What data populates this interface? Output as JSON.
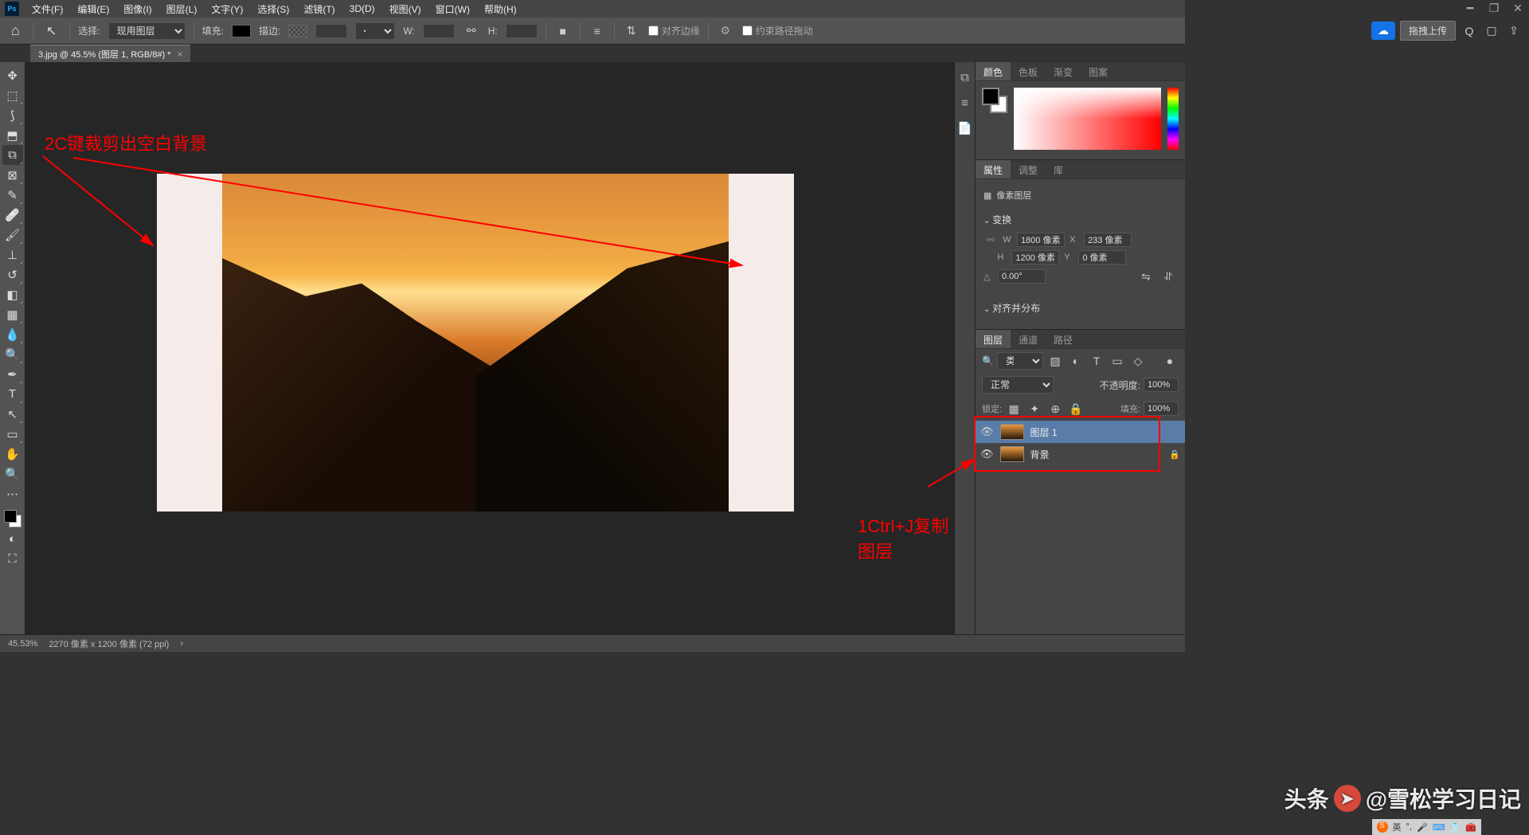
{
  "menubar": {
    "items": [
      "文件(F)",
      "编辑(E)",
      "图像(I)",
      "图层(L)",
      "文字(Y)",
      "选择(S)",
      "滤镜(T)",
      "3D(D)",
      "视图(V)",
      "窗口(W)",
      "帮助(H)"
    ]
  },
  "options_bar": {
    "select_label": "选择:",
    "select_value": "现用图层",
    "fill_label": "填充:",
    "stroke_label": "描边:",
    "w_label": "W:",
    "h_label": "H:",
    "align_edges_label": "对齐边缘",
    "constrain_path_label": "约束路径拖动",
    "upload_button": "拖拽上传"
  },
  "doc_tab": {
    "title": "3.jpg @ 45.5% (图层 1, RGB/8#) *"
  },
  "annotations": {
    "anno1": "2C键裁剪出空白背景",
    "anno2": "1Ctrl+J复制图层"
  },
  "color_panel": {
    "tabs": [
      "颜色",
      "色板",
      "渐变",
      "图案"
    ]
  },
  "properties_panel": {
    "tabs": [
      "属性",
      "调整",
      "库"
    ],
    "layer_type": "像素图层",
    "transform_label": "变换",
    "w_value": "1800 像素",
    "h_value": "1200 像素",
    "x_value": "233 像素",
    "y_value": "0 像素",
    "angle_value": "0.00°",
    "align_label": "对齐并分布"
  },
  "layers_panel": {
    "tabs": [
      "图层",
      "通道",
      "路径"
    ],
    "filter_label": "类型",
    "blend_mode": "正常",
    "opacity_label": "不透明度:",
    "opacity_value": "100%",
    "lock_label": "锁定:",
    "fill_label": "填充:",
    "fill_value": "100%",
    "layers": [
      {
        "name": "图层 1",
        "selected": true
      },
      {
        "name": "背景",
        "selected": false,
        "locked": true
      }
    ]
  },
  "status_bar": {
    "zoom": "45.53%",
    "dimensions": "2270 像素 x 1200 像素 (72 ppi)"
  },
  "watermark": "@雪松学习日记",
  "watermark_prefix": "头条",
  "ime": {
    "engine": "英"
  }
}
